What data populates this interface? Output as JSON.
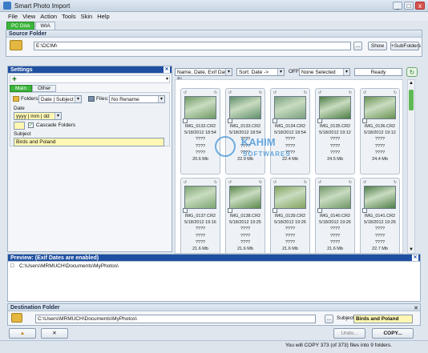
{
  "window": {
    "title": "Smart Photo Import",
    "buttons": [
      "_",
      "□",
      "x"
    ]
  },
  "menu": [
    "File",
    "View",
    "Action",
    "Tools",
    "Skin",
    "Help"
  ],
  "source_tabs": [
    "PC Disk",
    "WIA"
  ],
  "source": {
    "header": "Source Folder",
    "path": "E:\\DCIM\\",
    "browse_label": "...",
    "show_label": "Show",
    "subfolders_label": "+SubFolders"
  },
  "settings": {
    "header": "Settings",
    "tabs": [
      "Main",
      "Other"
    ],
    "folders_label": "Folders:",
    "folders_value": "Date | Subject",
    "files_label": "Files:",
    "files_value": "No Rename",
    "date_label": "Date",
    "date_value": "yyyy | mm | dd",
    "cascade_label": "Cascade Folders",
    "subject_label": "Subject",
    "subject_value": "Birds and Poland"
  },
  "toolbar": {
    "sort_field": "Name, Date, Exif Date, Si",
    "sort_order": "Sort: Date ->",
    "filter_toggle": "OFF",
    "filter_value": "None Selected",
    "status": "Ready"
  },
  "photos": [
    {
      "name": "IMG_0132.CR2",
      "date": "5/18/2012 18:54",
      "extra": "????",
      "size": "20.6 Mb",
      "color": "#6f9a63"
    },
    {
      "name": "IMG_0133.CR2",
      "date": "5/18/2012 18:54",
      "extra": "????",
      "size": "22.9 Mb",
      "color": "#5f8f6b"
    },
    {
      "name": "IMG_0134.CR2",
      "date": "5/18/2012 18:54",
      "extra": "????",
      "size": "22.4 Mb",
      "color": "#7aa080"
    },
    {
      "name": "IMG_0135.CR2",
      "date": "5/18/2012 19:12",
      "extra": "????",
      "size": "24.5 Mb",
      "color": "#4d7d45"
    },
    {
      "name": "IMG_0136.CR2",
      "date": "5/18/2012 19:12",
      "extra": "????",
      "size": "24.4 Mb",
      "color": "#6a9453"
    },
    {
      "name": "IMG_0137.CR2",
      "date": "5/18/2012 19:16",
      "extra": "????",
      "size": "21.6 Mb",
      "color": "#7ea673"
    },
    {
      "name": "IMG_0138.CR2",
      "date": "5/18/2012 19:25",
      "extra": "????",
      "size": "21.6 Mb",
      "color": "#5c8a4c"
    },
    {
      "name": "IMG_0139.CR2",
      "date": "5/18/2012 19:26",
      "extra": "????",
      "size": "21.6 Mb",
      "color": "#83a35e"
    },
    {
      "name": "IMG_0140.CR2",
      "date": "5/18/2012 19:26",
      "extra": "????",
      "size": "21.6 Mb",
      "color": "#6f9766"
    },
    {
      "name": "IMG_0141.CR2",
      "date": "5/18/2012 19:26",
      "extra": "????",
      "size": "22.7 Mb",
      "color": "#4f7f49"
    }
  ],
  "preview": {
    "header": "Preview: (Exif Dates are enabled)",
    "path": "C:\\Users\\MRMUCH\\Documents\\MyPhotos\\"
  },
  "destination": {
    "header": "Destination Folder",
    "path": "C:\\Users\\MRMUCH\\Documents\\MyPhotos\\",
    "browse_label": "...",
    "subject_label": "Subject:",
    "subject_value": "Birds and Poland"
  },
  "actions": {
    "undo_label": "Undo...",
    "copy_label": "COPY..."
  },
  "status_text": "You will COPY 373 (of 373) files into 9 folders.",
  "watermark": {
    "line1": "KAHIM",
    "line2": "SOFTWARES"
  }
}
